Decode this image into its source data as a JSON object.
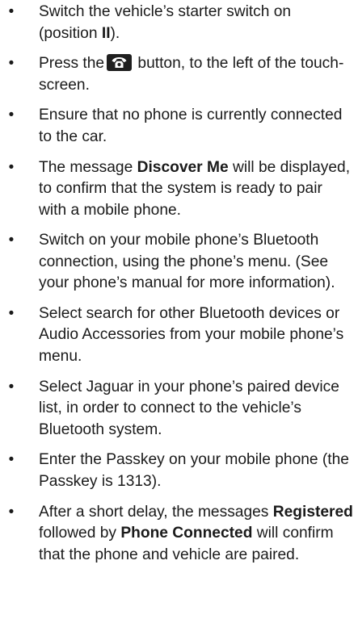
{
  "steps": [
    {
      "pre": "Switch the vehicle’s starter switch on (position ",
      "bold": "II",
      "post": ")."
    },
    {
      "pre": "Press the",
      "icon": "phone-button-icon",
      "post": " button, to the left of the touch-screen."
    },
    {
      "text": "Ensure that no phone is currently connected to the car."
    },
    {
      "pre": "The message ",
      "bold": "Discover Me",
      "post": " will be displayed, to confirm that the system is ready to pair with a mobile phone."
    },
    {
      "text": "Switch on your mobile phone’s Bluetooth connection, using the phone’s menu. (See your phone’s manual for more information)."
    },
    {
      "text": "Select search for other Bluetooth devices or Audio Accessories from your mobile phone’s menu."
    },
    {
      "text": "Select Jaguar in your phone’s paired device list, in order to connect to the vehicle’s Bluetooth system."
    },
    {
      "text": "Enter the Passkey on your mobile phone (the Passkey is 1313)."
    },
    {
      "pre": "After a short delay, the messages ",
      "bold": "Registered",
      "mid": " followed by ",
      "bold2": "Phone Connected",
      "post": " will confirm that the phone and vehicle are paired."
    }
  ],
  "bullet_char": "•"
}
